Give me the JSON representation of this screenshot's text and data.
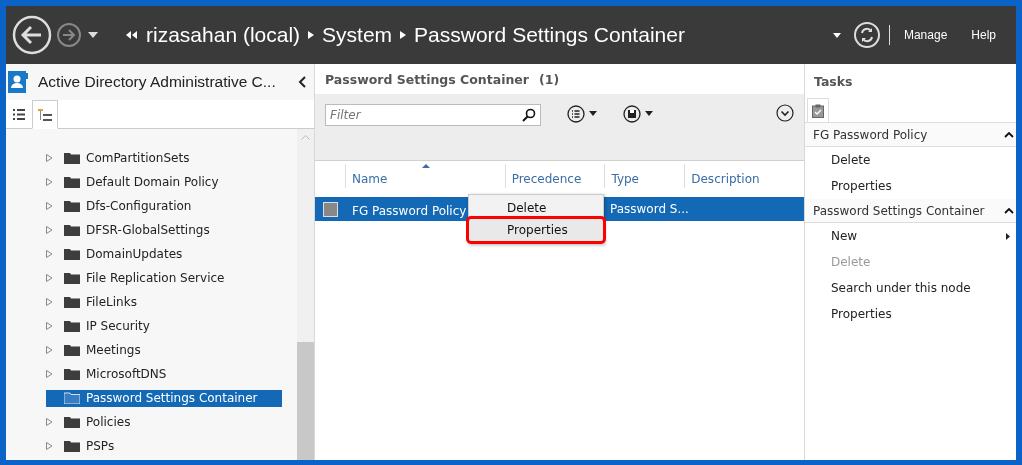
{
  "nav": {
    "breadcrumb": [
      "rizasahan (local)",
      "System",
      "Password Settings Container"
    ],
    "actions": [
      "Manage",
      "Help"
    ]
  },
  "navigation_pane": {
    "title": "Active Directory Administrative C...",
    "view_tabs": [
      {
        "kind": "list",
        "selected": false
      },
      {
        "kind": "tree",
        "selected": true
      }
    ],
    "tree": [
      {
        "name": "ComPartitionSets",
        "expandable": true,
        "selected": false
      },
      {
        "name": "Default Domain Policy",
        "expandable": true,
        "selected": false
      },
      {
        "name": "Dfs-Configuration",
        "expandable": true,
        "selected": false
      },
      {
        "name": "DFSR-GlobalSettings",
        "expandable": true,
        "selected": false
      },
      {
        "name": "DomainUpdates",
        "expandable": true,
        "selected": false
      },
      {
        "name": "File Replication Service",
        "expandable": true,
        "selected": false
      },
      {
        "name": "FileLinks",
        "expandable": true,
        "selected": false
      },
      {
        "name": "IP Security",
        "expandable": true,
        "selected": false
      },
      {
        "name": "Meetings",
        "expandable": true,
        "selected": false
      },
      {
        "name": "MicrosoftDNS",
        "expandable": true,
        "selected": false
      },
      {
        "name": "Password Settings Container",
        "expandable": false,
        "selected": true
      },
      {
        "name": "Policies",
        "expandable": true,
        "selected": false
      },
      {
        "name": "PSPs",
        "expandable": true,
        "selected": false
      }
    ]
  },
  "content": {
    "title": "Password Settings Container",
    "count": "(1)",
    "filter": {
      "placeholder": "Filter"
    },
    "columns": [
      "Name",
      "Precedence",
      "Type",
      "Description"
    ],
    "rows": [
      {
        "name": "FG Password Policy",
        "type": "Password S...",
        "selected": true
      }
    ],
    "context_menu": [
      {
        "label": "Delete",
        "highlighted": false
      },
      {
        "label": "Properties",
        "highlighted": true
      }
    ]
  },
  "tasks": {
    "title": "Tasks",
    "sections": [
      {
        "title": "FG Password Policy",
        "expanded": true,
        "items": [
          {
            "label": "Delete",
            "disabled": false,
            "submenu": false
          },
          {
            "label": "Properties",
            "disabled": false,
            "submenu": false
          }
        ]
      },
      {
        "title": "Password Settings Container",
        "expanded": true,
        "items": [
          {
            "label": "New",
            "disabled": false,
            "submenu": true
          },
          {
            "label": "Delete",
            "disabled": true,
            "submenu": false
          },
          {
            "label": "Search under this node",
            "disabled": false,
            "submenu": false
          },
          {
            "label": "Properties",
            "disabled": false,
            "submenu": false
          }
        ]
      }
    ]
  }
}
